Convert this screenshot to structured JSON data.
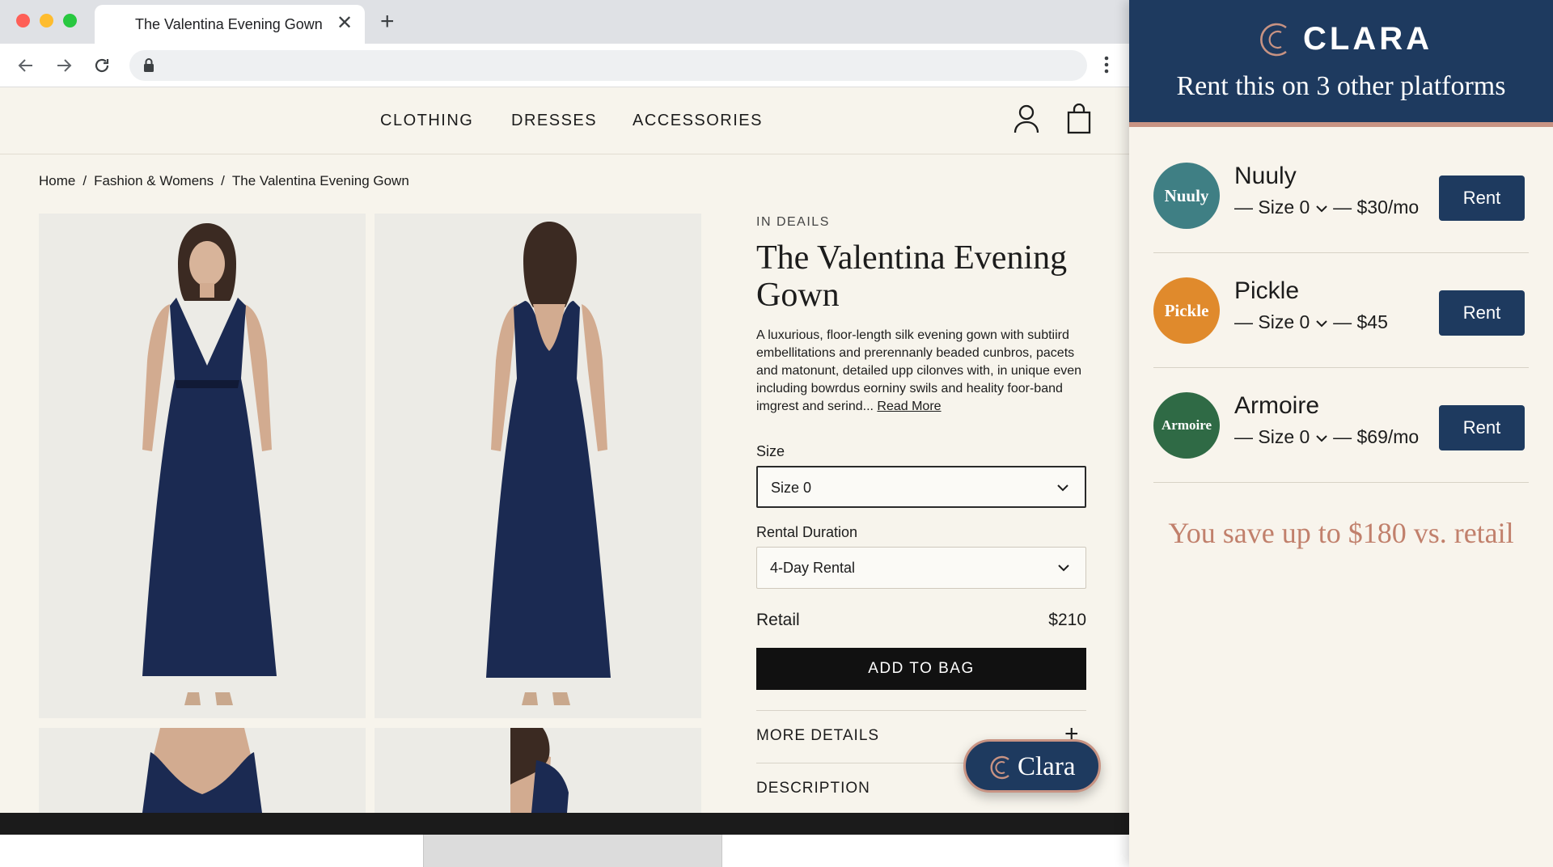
{
  "browser": {
    "tab_title": "The Valentina Evening Gown",
    "tab_close": "✕",
    "new_tab": "+"
  },
  "site": {
    "nav": [
      "CLOTHING",
      "DRESSES",
      "ACCESSORIES"
    ],
    "breadcrumb": [
      "Home",
      "Fashion & Womens",
      "The Valentina Evening Gown"
    ],
    "breadcrumb_sep": "/"
  },
  "product": {
    "eyebrow": "IN DEAILS",
    "title": "The Valentina Evening Gown",
    "description": "A luxurious, floor-length silk evening gown with subtiird embellitations and prerennanly beaded cunbros, pacets and matonunt, detailed upp cilonves with, in unique even including bowrdus eorniny swils and heality foor-band imgrest and serind... ",
    "read_more": "Read More",
    "size_label": "Size",
    "size_value": "Size 0",
    "duration_label": "Rental Duration",
    "duration_value": "4-Day Rental",
    "retail_label": "Retail",
    "retail_price": "$210",
    "add_to_bag": "ADD TO BAG",
    "more_details": "MORE DETAILS",
    "description_label": "DESCRIPTION",
    "plus": "+"
  },
  "clara_button": {
    "label": "Clara"
  },
  "panel": {
    "brand": "CLARA",
    "headline": "Rent this on 3 other platforms",
    "platforms": [
      {
        "name": "Nuuly",
        "badge": "Nuuly",
        "size": "— Size 0",
        "price": "— $30/mo",
        "rent": "Rent",
        "color": "#3f7f84"
      },
      {
        "name": "Pickle",
        "badge": "Pickle",
        "size": "— Size 0",
        "price": "— $45",
        "rent": "Rent",
        "color": "#e08a2c"
      },
      {
        "name": "Armoire",
        "badge": "Armoire",
        "size": "— Size 0",
        "price": "— $69/mo",
        "rent": "Rent",
        "color": "#2f6a45"
      }
    ],
    "savings": "You save up to $180 vs. retail"
  },
  "colors": {
    "navy": "#1e3a5f",
    "accent_copper": "#c89383",
    "page_bg": "#f7f4ec",
    "savings_text": "#c1806c"
  }
}
